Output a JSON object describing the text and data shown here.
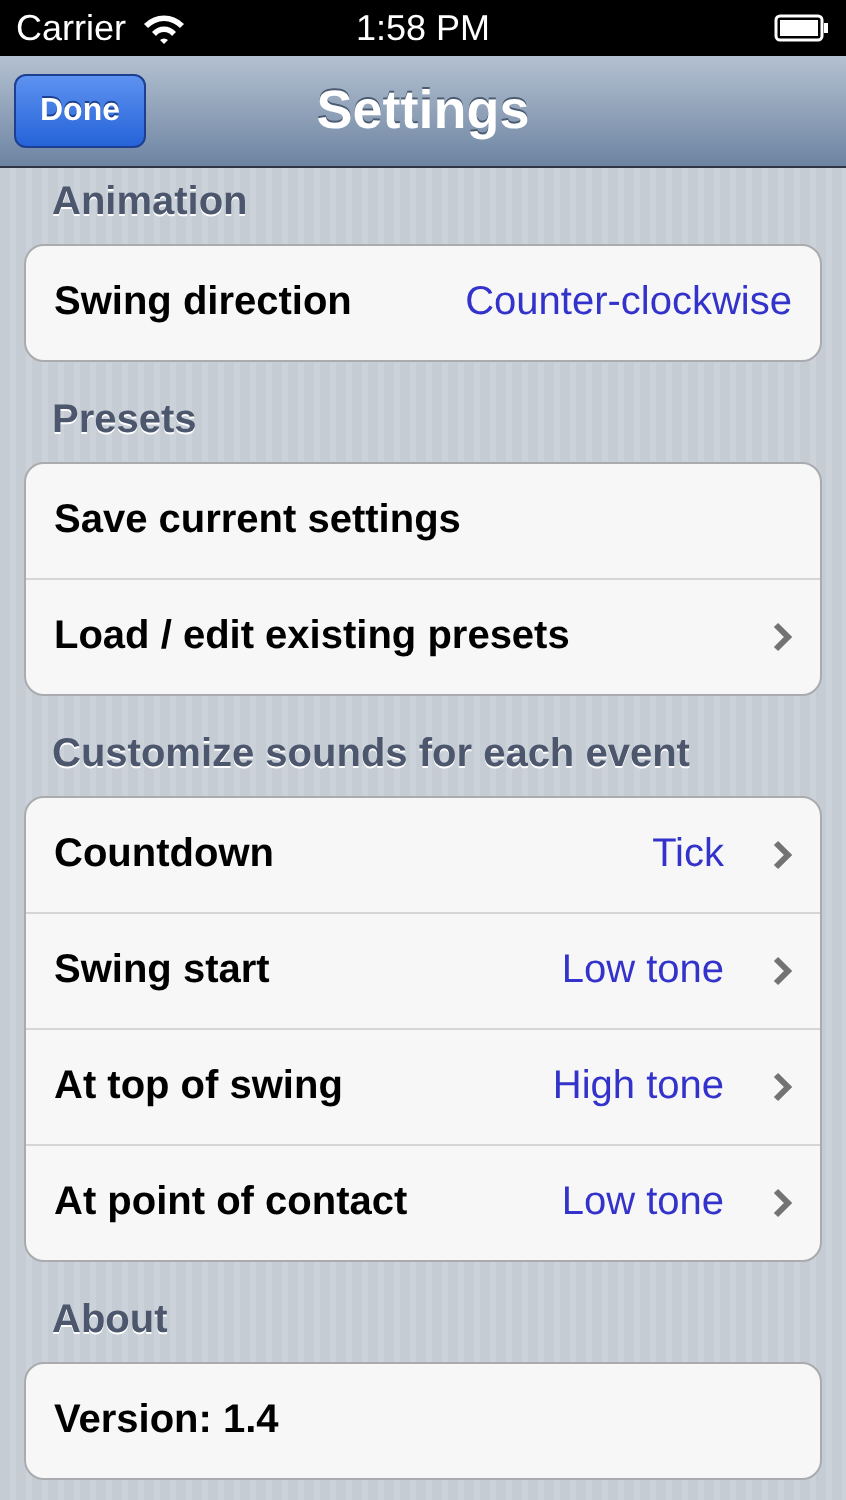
{
  "status_bar": {
    "carrier": "Carrier",
    "time": "1:58 PM"
  },
  "nav_bar": {
    "title": "Settings",
    "left_button": "Done"
  },
  "sections": [
    {
      "header": "Animation",
      "rows": [
        {
          "label": "Swing direction",
          "value": "Counter-clockwise",
          "disclosure": false
        }
      ]
    },
    {
      "header": "Presets",
      "rows": [
        {
          "label": "Save current settings",
          "disclosure": false
        },
        {
          "label": "Load / edit existing presets",
          "disclosure": true
        }
      ]
    },
    {
      "header": "Customize sounds for each event",
      "rows": [
        {
          "label": "Countdown",
          "value": "Tick",
          "disclosure": true
        },
        {
          "label": "Swing start",
          "value": "Low tone",
          "disclosure": true
        },
        {
          "label": "At top of swing",
          "value": "High tone",
          "disclosure": true
        },
        {
          "label": "At point of contact",
          "value": "Low tone",
          "disclosure": true
        }
      ]
    },
    {
      "header": "About",
      "rows": [
        {
          "label": "Version: 1.4",
          "disclosure": false
        }
      ]
    }
  ]
}
